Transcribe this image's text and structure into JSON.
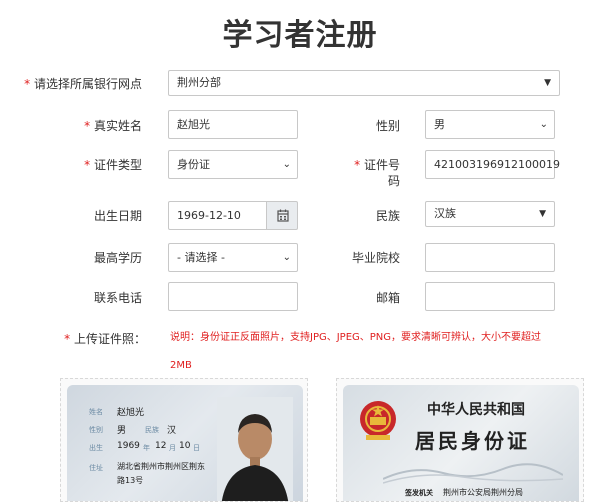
{
  "page": {
    "title": "学习者注册"
  },
  "form": {
    "bank": {
      "label": "请选择所属银行网点",
      "value": "荆州分部"
    },
    "name": {
      "label": "真实姓名",
      "value": "赵旭光"
    },
    "gender": {
      "label": "性别",
      "value": "男"
    },
    "id_type": {
      "label": "证件类型",
      "value": "身份证"
    },
    "id_number": {
      "label_line1": "证件号",
      "label_line2": "码",
      "value": "421003196912100019"
    },
    "birth": {
      "label": "出生日期",
      "value": "1969-12-10"
    },
    "ethnicity": {
      "label": "民族",
      "value": "汉族"
    },
    "education": {
      "label": "最高学历",
      "value": "- 请选择 -"
    },
    "school": {
      "label": "毕业院校",
      "value": ""
    },
    "phone": {
      "label": "联系电话",
      "value": ""
    },
    "email": {
      "label": "邮箱",
      "value": ""
    },
    "upload": {
      "label": "上传证件照：",
      "hint_line1": "说明：身份证正反面照片，支持JPG、JPEG、PNG，要求清晰可辨认，大小不要超过",
      "hint_line2": "2MB"
    },
    "required_mark": "*"
  },
  "id_front": {
    "name_label": "姓名",
    "name": "赵旭光",
    "sex_label": "性别",
    "sex": "男",
    "nation_label": "民族",
    "nation": "汉",
    "birth_label": "出生",
    "birth_year": "1969",
    "birth_year_unit": "年",
    "birth_month": "12",
    "birth_month_unit": "月",
    "birth_day": "10",
    "birth_day_unit": "日",
    "addr_label": "住址",
    "addr_line1": "湖北省荆州市荆州区荆东",
    "addr_line2": "路13号"
  },
  "id_back": {
    "country": "中华人民共和国",
    "card_title": "居民身份证",
    "authority_label": "签发机关",
    "authority": "荆州市公安局荆州分局"
  },
  "colors": {
    "required": "#e02020",
    "border": "#c8c8c8",
    "label": "#333333"
  }
}
